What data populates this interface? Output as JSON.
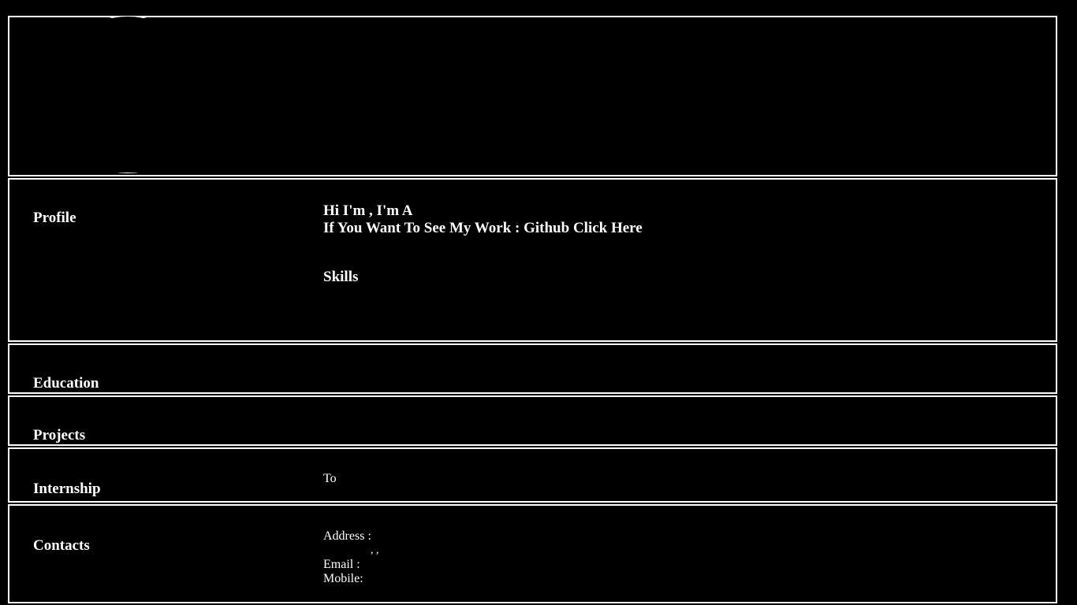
{
  "profile": {
    "title": "Profile",
    "intro_line": "Hi I'm , I'm A",
    "github_prefix": "If You Want To See My Work : Github ",
    "github_link": "Click Here",
    "skills_heading": "Skills"
  },
  "education": {
    "title": "Education"
  },
  "projects": {
    "title": "Projects"
  },
  "internship": {
    "title": "Internship",
    "to_label": "To"
  },
  "contacts": {
    "title": "Contacts",
    "address_label": "Address :",
    "address_commas": ", ,",
    "email_label": "Email :",
    "mobile_label": "Mobile:"
  }
}
